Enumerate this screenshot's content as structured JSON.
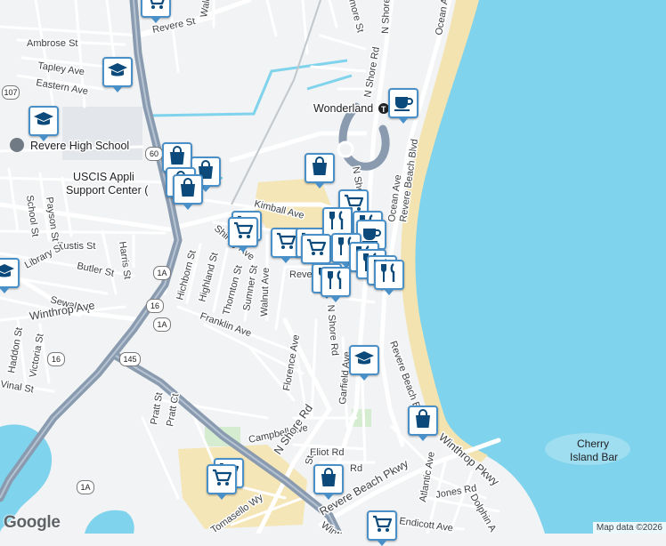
{
  "colors": {
    "water": "#7fd3ec",
    "beach": "#f3e3b0",
    "land": "#f1f3f4",
    "park": "#cfe8c9",
    "highway": "#8a9bb0",
    "road": "#ffffff",
    "pin_border": "#4a90c8",
    "pin_icon": "#0b4a7a"
  },
  "attribution": "Map data ©2026",
  "logo": "Google",
  "streets": {
    "revere_st": "Revere St",
    "walden": "Walde",
    "ambrose_st": "Ambrose St",
    "tapley_ave": "Tapley Ave",
    "eastern_ave": "Eastern Ave",
    "n_shore_rd_1": "N Shore Rd",
    "n_shore_rd_2": "N Shore Rd",
    "n_shore_rd_3": "N Shore Rd",
    "n_shore_rd_4": "N Shore Rd",
    "n_shore_rd_5": "N Shore Rd",
    "ocean_ave_1": "Ocean Ave",
    "ocean_ave_2": "Ocean Ave",
    "revere_beach_blvd_1": "Revere Beach Blvd",
    "revere_beach_blvd_2": "Revere Beach Blvd",
    "kimball_ave": "Kimball Ave",
    "shirley_ave": "Shirley Ave",
    "eustis_st": "Eustis St",
    "butler_st": "Butler St",
    "library_st": "Library St",
    "sewall_st": "Sewall St",
    "winthrop_ave": "Winthrop Ave",
    "school_st": "School St",
    "payson_st": "Payson St",
    "harris_st": "Harris St",
    "hichborn_st": "Hichborn St",
    "highland_st": "Highland St",
    "thornton_st": "Thornton St",
    "sumner_st": "Sumner St",
    "walnut_ave": "Walnut Ave",
    "franklin_ave": "Franklin Ave",
    "haddon_st": "Haddon St",
    "victoria_st": "Victoria St",
    "vinal_st": "Vinal St",
    "florence_ave": "Florence Ave",
    "garfield_ave": "Garfield Ave",
    "pratt_st": "Pratt St",
    "pratt_ct": "Pratt Ct",
    "campbell_ave": "Campbell Ave",
    "eliot_rd": "Eliot Rd",
    "rd_fragment": "Rd",
    "revere_beach_pkwy": "Revere Beach Pkwy",
    "winthrop_pkwy": "Winthrop Pkwy",
    "atlantic_ave": "Atlantic Ave",
    "jones_rd": "Jones Rd",
    "dolphin_a": "Dolphin A",
    "endicott_ave": "Endicott Ave",
    "tomasello_wy": "Tomasello Wy",
    "more_st": "more St",
    "revere_fragment": "Reve",
    "st_fragment": "St",
    "winth_fragment": "Winth"
  },
  "places": {
    "wonderland": "Wonderland",
    "revere_high_school": "Revere High School",
    "uscis_line1": "USCIS Appli",
    "uscis_line2": "Support Center (",
    "cherry_island_line1": "Cherry",
    "cherry_island_line2": "Island Bar"
  },
  "shields": {
    "s107": "107",
    "s60": "60",
    "s1a_1": "1A",
    "s1a_2": "1A",
    "s1a_3": "1A",
    "s16_1": "16",
    "s16_2": "16",
    "s145": "145"
  },
  "markers": [
    {
      "kind": "shopping-cart"
    },
    {
      "kind": "school"
    },
    {
      "kind": "school"
    },
    {
      "kind": "shopping-bag"
    },
    {
      "kind": "shopping-bag"
    },
    {
      "kind": "shopping-bag"
    },
    {
      "kind": "shopping-bag"
    },
    {
      "kind": "coffee"
    },
    {
      "kind": "shopping-bag"
    },
    {
      "kind": "shopping-cart"
    },
    {
      "kind": "shopping-cart"
    },
    {
      "kind": "shopping-cart"
    },
    {
      "kind": "shopping-cart"
    },
    {
      "kind": "shopping-cart"
    },
    {
      "kind": "restaurant"
    },
    {
      "kind": "restaurant"
    },
    {
      "kind": "coffee"
    },
    {
      "kind": "shopping-cart"
    },
    {
      "kind": "restaurant"
    },
    {
      "kind": "restaurant"
    },
    {
      "kind": "restaurant"
    },
    {
      "kind": "restaurant"
    },
    {
      "kind": "restaurant"
    },
    {
      "kind": "restaurant"
    },
    {
      "kind": "restaurant"
    },
    {
      "kind": "school"
    },
    {
      "kind": "shopping-bag"
    },
    {
      "kind": "shopping-cart"
    },
    {
      "kind": "shopping-cart"
    },
    {
      "kind": "shopping-bag"
    },
    {
      "kind": "school"
    },
    {
      "kind": "shopping-cart"
    }
  ]
}
